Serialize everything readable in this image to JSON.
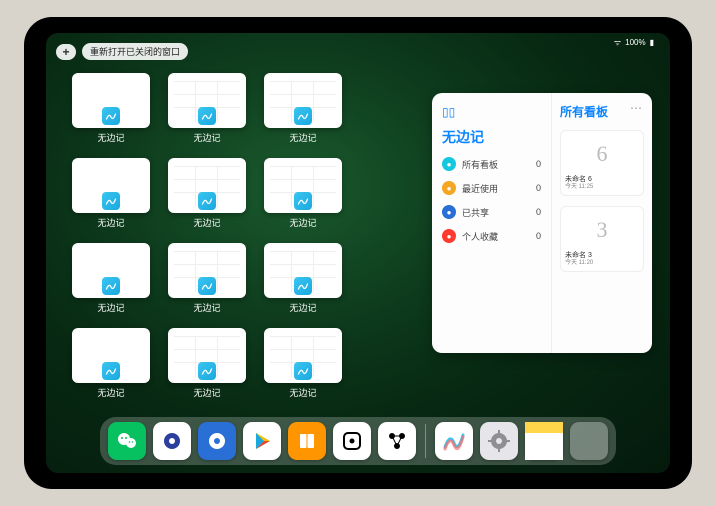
{
  "status": {
    "battery": "100%",
    "wifi": "●"
  },
  "topbar": {
    "plus": "+",
    "reopen_label": "重新打开已关闭的窗口"
  },
  "thumbs": [
    {
      "label": "无边记",
      "variant": "blank"
    },
    {
      "label": "无边记",
      "variant": "grid"
    },
    {
      "label": "无边记",
      "variant": "grid"
    },
    {
      "label": "无边记",
      "variant": "blank"
    },
    {
      "label": "无边记",
      "variant": "grid"
    },
    {
      "label": "无边记",
      "variant": "grid"
    },
    {
      "label": "无边记",
      "variant": "blank"
    },
    {
      "label": "无边记",
      "variant": "grid"
    },
    {
      "label": "无边记",
      "variant": "grid"
    },
    {
      "label": "无边记",
      "variant": "blank"
    },
    {
      "label": "无边记",
      "variant": "grid"
    },
    {
      "label": "无边记",
      "variant": "grid"
    }
  ],
  "panel": {
    "left_title": "无边记",
    "categories": [
      {
        "label": "所有看板",
        "count": "0",
        "color": "#16c7e0"
      },
      {
        "label": "最近使用",
        "count": "0",
        "color": "#f5a623"
      },
      {
        "label": "已共享",
        "count": "0",
        "color": "#2a6fd6"
      },
      {
        "label": "个人收藏",
        "count": "0",
        "color": "#ff3b30"
      }
    ],
    "right_title": "所有看板",
    "boards": [
      {
        "sketch": "6",
        "name": "未命名 6",
        "time": "今天 11:25"
      },
      {
        "sketch": "3",
        "name": "未命名 3",
        "time": "今天 11:20"
      }
    ]
  },
  "dock": {
    "apps": [
      {
        "name": "wechat",
        "bg": "#07c160",
        "glyph": "wechat"
      },
      {
        "name": "quark-hd",
        "bg": "#ffffff",
        "glyph": "quark-blue"
      },
      {
        "name": "quark",
        "bg": "#2a6fd6",
        "glyph": "quark-white"
      },
      {
        "name": "play",
        "bg": "#ffffff",
        "glyph": "play"
      },
      {
        "name": "books",
        "bg": "#ff9500",
        "glyph": "books"
      },
      {
        "name": "dice",
        "bg": "#ffffff",
        "glyph": "dice"
      },
      {
        "name": "connect",
        "bg": "#ffffff",
        "glyph": "connect"
      }
    ],
    "recent": [
      {
        "name": "freeform",
        "bg": "#ffffff",
        "glyph": "freeform"
      },
      {
        "name": "settings",
        "bg": "#e5e5ea",
        "glyph": "gear"
      },
      {
        "name": "notes",
        "bg": "#ffffff",
        "glyph": "notes"
      }
    ],
    "folder": {
      "cells": [
        "#3ac5f0",
        "#ff6b6b",
        "#4cd964",
        "#1a8cff"
      ]
    }
  }
}
